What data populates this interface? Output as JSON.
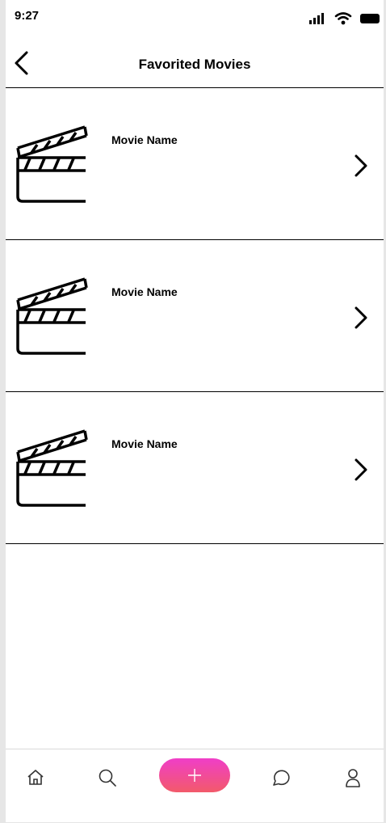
{
  "status_bar": {
    "time": "9:27",
    "icons": [
      "signal-icon",
      "wifi-icon",
      "battery-icon"
    ]
  },
  "header": {
    "title": "Favorited Movies",
    "back_icon": "chevron-left-icon"
  },
  "movies": [
    {
      "name": "Movie Name",
      "icon": "clapperboard-icon",
      "action_icon": "chevron-right-icon"
    },
    {
      "name": "Movie Name",
      "icon": "clapperboard-icon",
      "action_icon": "chevron-right-icon"
    },
    {
      "name": "Movie Name",
      "icon": "clapperboard-icon",
      "action_icon": "chevron-right-icon"
    }
  ],
  "bottom_nav": {
    "items": [
      "home-icon",
      "search-icon",
      "plus-icon",
      "chat-icon",
      "profile-icon"
    ],
    "add_button_colors": [
      "#f03ec8",
      "#f25a6a"
    ]
  }
}
